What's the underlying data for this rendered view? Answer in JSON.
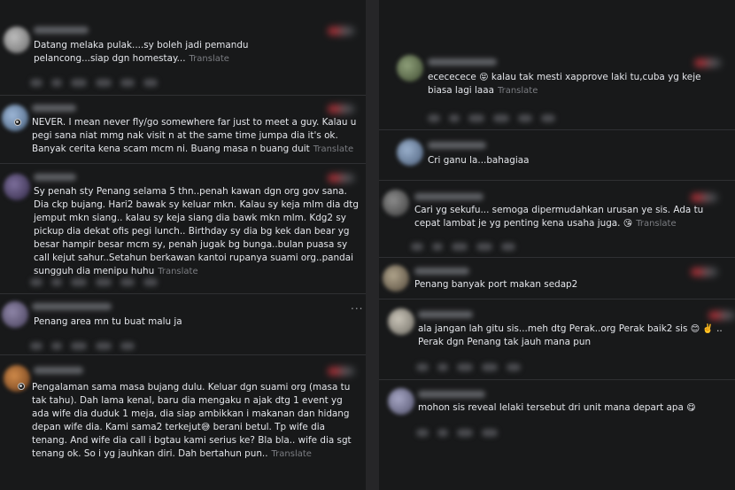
{
  "left": [
    {
      "text": "Datang melaka pulak....sy boleh jadi pemandu pelancong...siap dgn homestay...",
      "translate": "Translate"
    },
    {
      "text": "NEVER. I mean never fly/go somewhere far just to meet a guy. Kalau u pegi sana niat mmg nak visit n at the same time jumpa dia it's ok. Banyak cerita kena scam mcm ni. Buang masa n buang duit",
      "translate": "Translate"
    },
    {
      "text": "Sy penah sty Penang selama 5 thn..penah kawan dgn org gov sana. Dia ckp bujang. Hari2 bawak sy keluar mkn. Kalau sy keja mlm dia dtg jemput mkn siang.. kalau sy keja siang dia bawk mkn mlm. Kdg2 sy pickup dia dekat ofis pegi lunch.. Birthday sy dia bg kek dan bear yg besar hampir besar mcm sy, penah jugak bg bunga..bulan puasa sy call kejut sahur..Setahun berkawan kantoi rupanya suami org..pandai sungguh dia menipu huhu",
      "translate": "Translate"
    },
    {
      "text": "Penang area mn tu buat malu ja",
      "more": "..."
    },
    {
      "text_a": "Pengalaman sama masa bujang dulu. Keluar dgn suami org (masa tu tak tahu). Dah lama kenal, baru dia mengaku n ajak dtg 1 event yg ada wife dia duduk 1 meja, dia siap ambikkan i makanan dan hidang depan wife dia. Kami sama2 terkejut",
      "emoji": "😅",
      "text_b": " berani betul. Tp wife dia tenang. And wife dia call i bgtau kami serius ke? Bla bla.. wife dia sgt tenang ok. So i yg jauhkan diri. Dah bertahun pun..",
      "translate": "Translate"
    }
  ],
  "right": [
    {
      "text_a": "ececececе ",
      "emoji": "😝",
      "text_b": " kalau tak mesti xapprove laki tu,cuba yg keje biasa lagi laaa",
      "translate": "Translate"
    },
    {
      "text": "Cri ganu la...bahagiaa"
    },
    {
      "text_a": "Cari yg sekufu... semoga dipermudahkan urusan ye sis. Ada tu cepat lambat je yg penting kena usaha juga. ",
      "emoji": "😘",
      "translate": "Translate"
    },
    {
      "text": "Penang banyak port makan sedap2"
    },
    {
      "text_a": "ala jangan lah gitu sis...meh dtg Perak..org Perak baik2 sis ",
      "emoji": "😊 ✌️",
      "text_b": " .. Perak dgn Penang tak jauh mana pun"
    },
    {
      "text_a": "mohon sis reveal lelaki tersebut dri unit mana depart apa ",
      "emoji": "😋"
    }
  ],
  "colors": {
    "background": "#18191a",
    "text": "#e4e6eb",
    "muted": "#7b7d82"
  }
}
